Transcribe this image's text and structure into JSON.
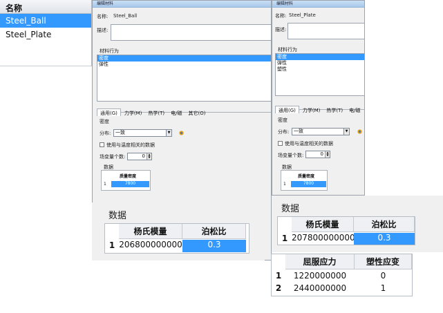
{
  "material_list": {
    "header": "名称",
    "items": [
      {
        "label": "Steel_Ball",
        "selected": true
      },
      {
        "label": "Steel_Plate",
        "selected": false
      }
    ]
  },
  "dialogs": [
    {
      "title": "编辑材料",
      "name_label": "名称:",
      "name_value": "Steel_Ball",
      "desc_label": "描述:",
      "behavior_label": "材料行为",
      "behaviors": [
        "密度",
        "弹性"
      ],
      "tabs": [
        "通用(G)",
        "力学(M)",
        "热学(T)",
        "电/磁",
        "其它(O)"
      ],
      "section": "密度",
      "distribution_label": "分布:",
      "distribution_value": "一致",
      "temp_checkbox": "使用与温度相关的数据",
      "field_vars_label": "场变量个数:",
      "field_vars_value": "0",
      "data_label": "数据",
      "data_header": "质量密度",
      "data_row": "1",
      "data_value": "7800"
    },
    {
      "title": "编辑材料",
      "name_label": "名称:",
      "name_value": "Steel_Plate",
      "desc_label": "描述:",
      "behavior_label": "材料行为",
      "behaviors": [
        "密度",
        "弹性",
        "塑性"
      ],
      "tabs": [
        "通用(G)",
        "力学(M)",
        "热学(T)",
        "电/磁"
      ],
      "section": "密度",
      "distribution_label": "分布:",
      "distribution_value": "一致",
      "temp_checkbox": "使用与温度相关的数据",
      "field_vars_label": "场变量个数:",
      "field_vars_value": "0",
      "data_label": "数据",
      "data_header": "质量密度",
      "data_row": "1",
      "data_value": "7800"
    }
  ],
  "elastic_ball": {
    "title": "数据",
    "headers": [
      "杨氏模量",
      "泊松比"
    ],
    "rows": [
      {
        "n": "1",
        "youngs": "206800000000",
        "poisson": "0.3"
      }
    ]
  },
  "elastic_plate": {
    "title": "数据",
    "headers": [
      "杨氏模量",
      "泊松比"
    ],
    "rows": [
      {
        "n": "1",
        "youngs": "207800000000",
        "poisson": "0.3"
      }
    ]
  },
  "plastic_plate": {
    "headers": [
      "屈服应力",
      "塑性应变"
    ],
    "rows": [
      {
        "n": "1",
        "stress": "1220000000",
        "strain": "0"
      },
      {
        "n": "2",
        "stress": "2440000000",
        "strain": "1"
      }
    ]
  },
  "icons": {
    "wand": "wand-icon"
  },
  "colors": {
    "selection": "#3399ff",
    "dialog_bg": "#f0f0f0"
  }
}
